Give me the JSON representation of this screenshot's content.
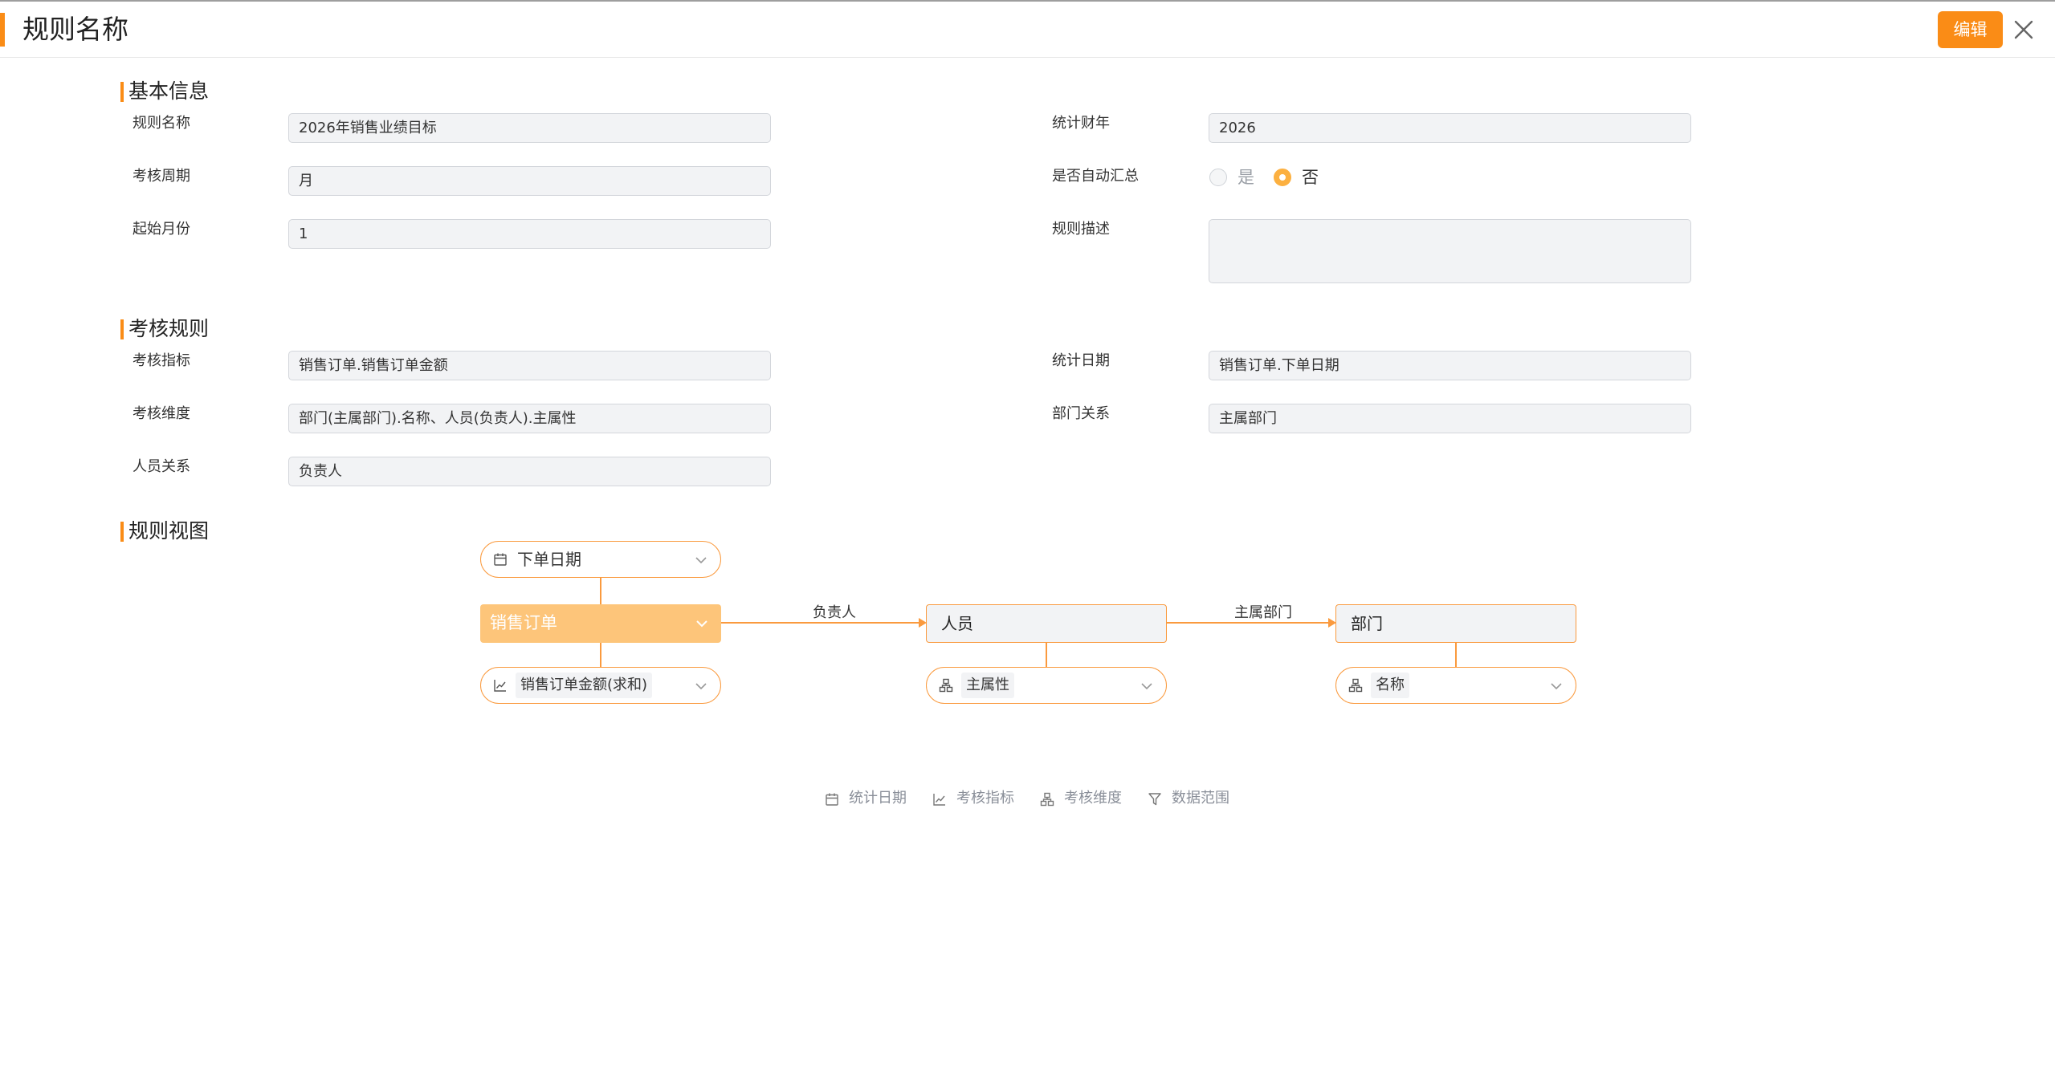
{
  "colors": {
    "accent": "#fa8c16",
    "node_main": "#fdc57a",
    "border": "#fa9a3e",
    "legend_text": "#8a8f99"
  },
  "header": {
    "title": "规则名称",
    "edit_label": "编辑",
    "close_icon": "close-icon"
  },
  "basic": {
    "title": "基本信息",
    "rule_name": {
      "label": "规则名称",
      "value": "2026年销售业绩目标"
    },
    "fiscal_year": {
      "label": "统计财年",
      "value": "2026"
    },
    "period": {
      "label": "考核周期",
      "value": "月"
    },
    "auto_sum": {
      "label": "是否自动汇总",
      "options": [
        "是",
        "否"
      ],
      "selected": "否"
    },
    "start_month": {
      "label": "起始月份",
      "value": "1"
    },
    "description": {
      "label": "规则描述",
      "value": ""
    }
  },
  "assessment": {
    "title": "考核规则",
    "indicator": {
      "label": "考核指标",
      "value": "销售订单.销售订单金额"
    },
    "stat_date": {
      "label": "统计日期",
      "value": "销售订单.下单日期"
    },
    "dimension": {
      "label": "考核维度",
      "value": "部门(主属部门).名称、人员(负责人).主属性"
    },
    "dept_relation": {
      "label": "部门关系",
      "value": "主属部门"
    },
    "person_relation": {
      "label": "人员关系",
      "value": "负责人"
    }
  },
  "view": {
    "title": "规则视图",
    "date_field": {
      "label": "下单日期",
      "icon": "calendar-icon"
    },
    "main_entity": {
      "label": "销售订单"
    },
    "measure": {
      "label": "销售订单金额(求和)",
      "icon": "line-chart-icon"
    },
    "edge1": "负责人",
    "person": {
      "label": "人员"
    },
    "person_attr": {
      "label": "主属性",
      "icon": "hierarchy-icon"
    },
    "edge2": "主属部门",
    "dept": {
      "label": "部门"
    },
    "dept_attr": {
      "label": "名称",
      "icon": "hierarchy-icon"
    }
  },
  "legend": [
    {
      "label": "统计日期",
      "icon": "calendar-icon"
    },
    {
      "label": "考核指标",
      "icon": "line-chart-icon"
    },
    {
      "label": "考核维度",
      "icon": "hierarchy-icon"
    },
    {
      "label": "数据范围",
      "icon": "filter-icon"
    }
  ]
}
